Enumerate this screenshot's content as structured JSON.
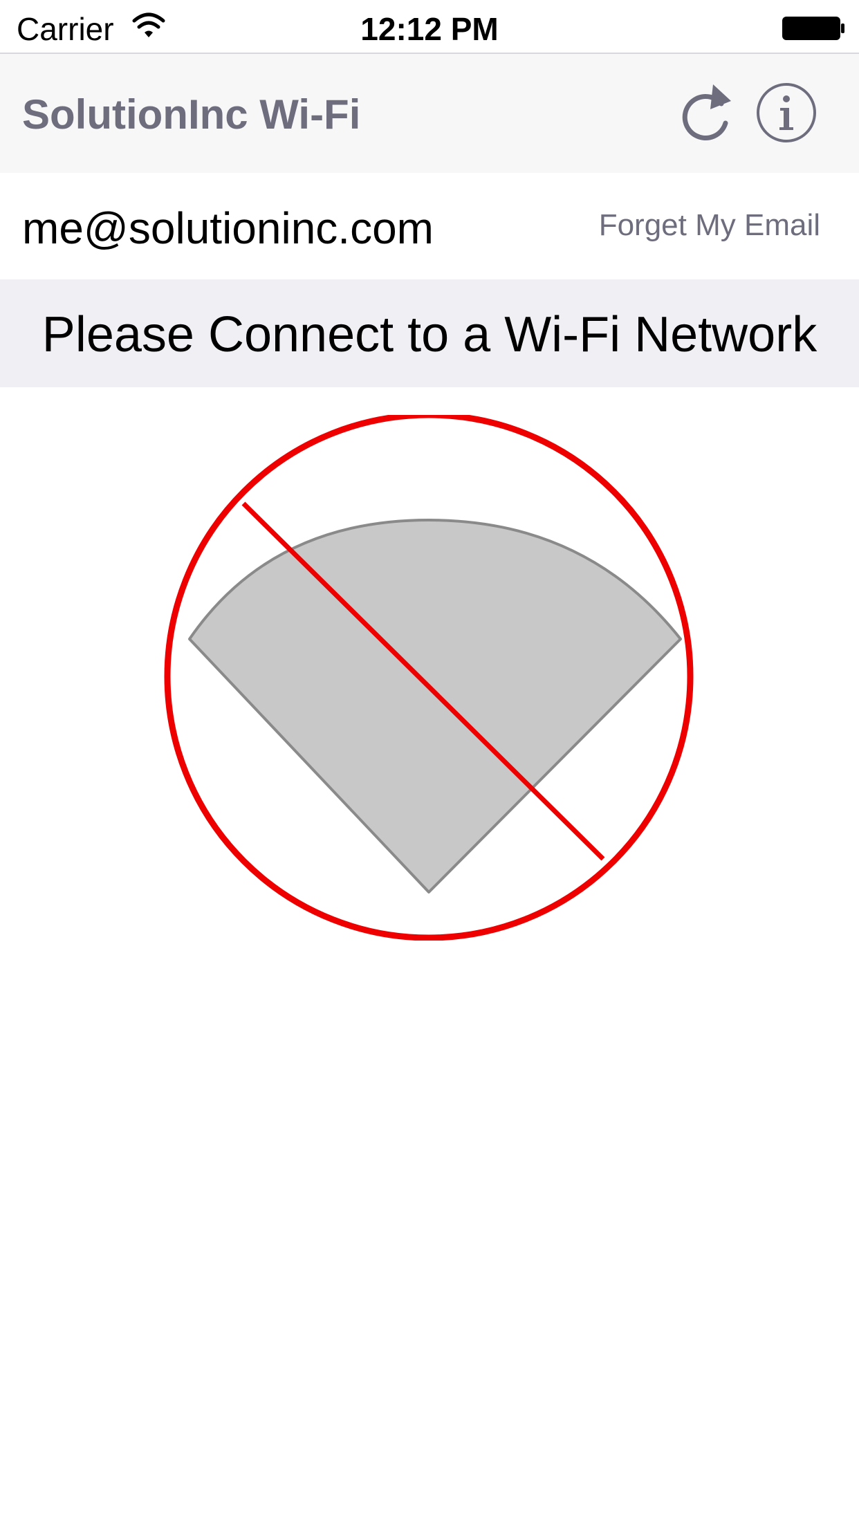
{
  "status_bar": {
    "carrier": "Carrier",
    "time": "12:12 PM",
    "wifi_icon": "wifi-signal-icon",
    "battery_icon": "battery-full-icon"
  },
  "nav_bar": {
    "title": "SolutionInc Wi-Fi",
    "refresh_icon": "refresh-icon",
    "info_icon": "info-icon",
    "tint_color": "#6e6d7e"
  },
  "email_row": {
    "email": "me@solutioninc.com",
    "forget_label": "Forget My Email"
  },
  "message": {
    "text": "Please Connect to a Wi-Fi Network"
  },
  "graphic": {
    "icon": "no-wifi-icon",
    "wedge_color": "#c8c8c8",
    "prohibit_color": "#ee0000"
  }
}
